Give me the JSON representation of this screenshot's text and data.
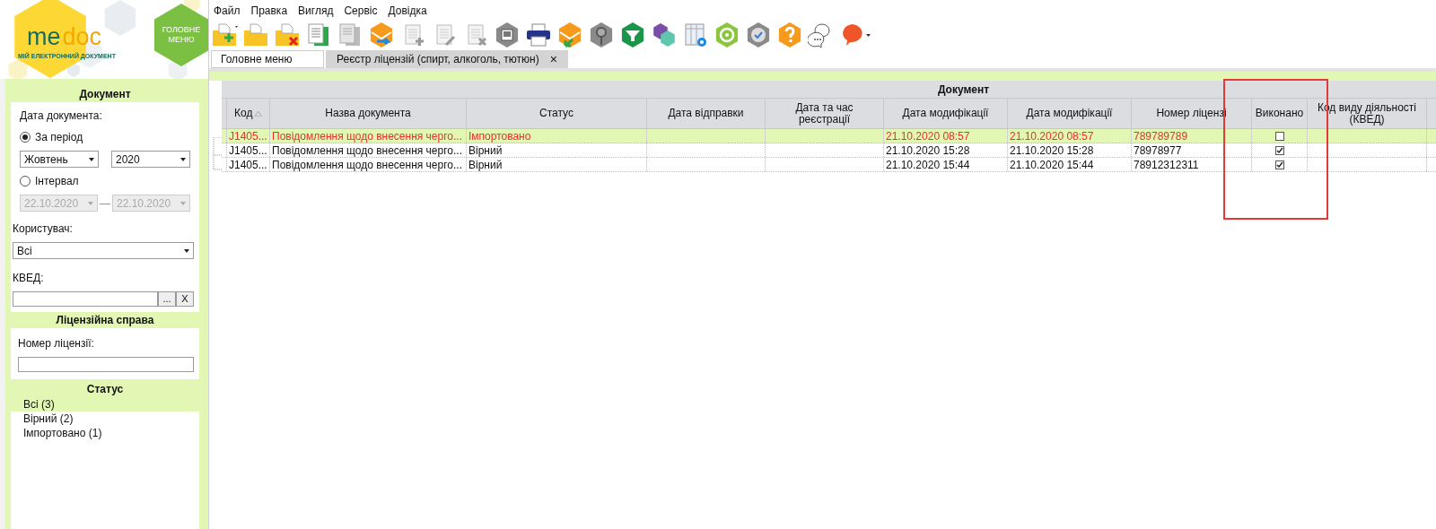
{
  "logo": {
    "brand_left": "me",
    "brand_right": "doc",
    "tagline": "МІЙ ЕЛЕКТРОННИЙ ДОКУМЕНТ"
  },
  "main_menu_button": {
    "label": "ГОЛОВНЕ МЕНЮ"
  },
  "menu": [
    "Файл",
    "Правка",
    "Вигляд",
    "Сервіс",
    "Довідка"
  ],
  "tabs": [
    {
      "label": "Головне меню",
      "selected": false
    },
    {
      "label": "Реєстр ліцензій (спирт, алкоголь, тютюн)",
      "selected": true,
      "close": "×"
    }
  ],
  "filters": {
    "document": {
      "title": "Документ",
      "date_label": "Дата документа:",
      "period": {
        "label": "За період",
        "selected": true,
        "month": "Жовтень",
        "year": "2020"
      },
      "interval": {
        "label": "Інтервал",
        "selected": false,
        "from": "22.10.2020",
        "to": "22.10.2020",
        "dash": "—"
      },
      "user_label": "Користувач:",
      "user": "Всі",
      "kved_label": "КВЕД:",
      "kved_browse": "...",
      "kved_clear": "X"
    },
    "license": {
      "title": "Ліцензійна справа",
      "number_label": "Номер ліцензії:"
    },
    "status": {
      "title": "Статус",
      "items": [
        {
          "label": "Всі (3)",
          "selected": true
        },
        {
          "label": "Вірний (2)",
          "selected": false
        },
        {
          "label": "Імпортовано (1)",
          "selected": false
        }
      ]
    }
  },
  "table": {
    "group_header": "Документ",
    "columns": [
      "Код",
      "Назва документа",
      "Статус",
      "Дата відправки",
      "Дата та час реєстрації",
      "Дата модифікації",
      "Дата модифікації",
      "Номер ліцензі",
      "Виконано",
      "Код виду діяльності (КВЕД)"
    ],
    "rows": [
      {
        "kind": "imported",
        "selected": true,
        "done": false,
        "cells": [
          "J1405...",
          "Повідомлення щодо внесення черго...",
          "Імпортовано",
          "",
          "",
          "21.10.2020 08:57",
          "21.10.2020 08:57",
          "789789789"
        ]
      },
      {
        "kind": "valid",
        "selected": false,
        "done": true,
        "cells": [
          "J1405...",
          "Повідомлення щодо внесення черго...",
          "Вірний",
          "",
          "",
          "21.10.2020 15:28",
          "21.10.2020 15:28",
          "78978977"
        ]
      },
      {
        "kind": "valid",
        "selected": false,
        "done": true,
        "cells": [
          "J1405...",
          "Повідомлення щодо внесення черго...",
          "Вірний",
          "",
          "",
          "21.10.2020 15:44",
          "21.10.2020 15:44",
          "78912312311"
        ]
      }
    ]
  }
}
